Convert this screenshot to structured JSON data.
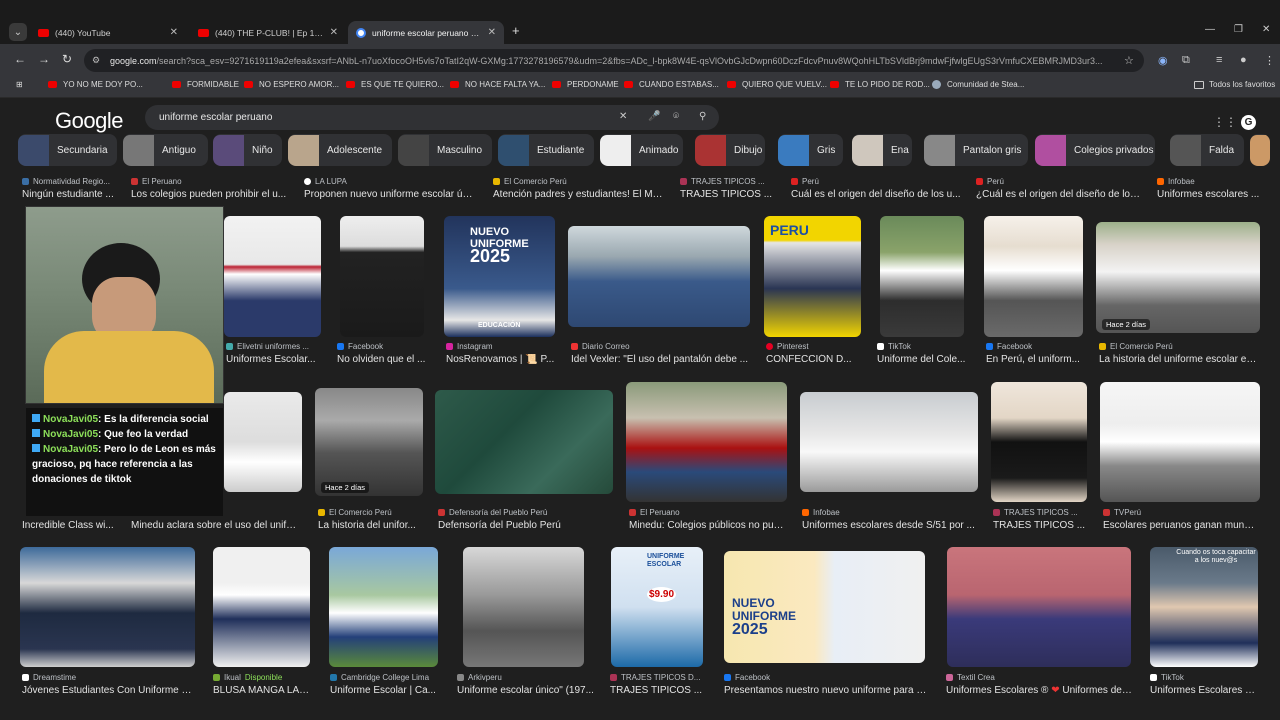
{
  "tabs": [
    {
      "title": "(440) YouTube",
      "type": "yt"
    },
    {
      "title": "(440) THE P-CLUB! | Ep 1: Desp",
      "type": "yt"
    },
    {
      "title": "uniforme escolar peruano - Bus",
      "type": "g"
    }
  ],
  "address": {
    "host": "google.com",
    "path": "/search?sca_esv=9271619119a2efea&sxsrf=ANbL-n7uoXfocoOH5vls7oTatI2qW-GXMg:1773278196579&udm=2&fbs=ADc_l-bpk8W4E-qsVlOvbGJcDwpn60DczFdcvPnuv8WQohHLTbSVldBrj9mdwFjfwlgEUgS3rVmfuCXEBMRJMD3ur3..."
  },
  "bookmarks": [
    "YO NO ME DOY PO...",
    "FORMIDABLE",
    "NO ESPERO AMOR...",
    "ES QUE TE QUIERO...",
    "NO HACE FALTA YA...",
    "PERDONAME",
    "CUANDO ESTABAS...",
    "QUIERO QUE VUELV...",
    "TE LO PIDO DE ROD...",
    "Comunidad de Stea..."
  ],
  "bookmarks_all": "Todos los favoritos",
  "google": {
    "logo": "Google",
    "query": "uniforme escolar peruano"
  },
  "chips": [
    "Secundaria",
    "Antiguo",
    "Niño",
    "Adolescente",
    "Masculino",
    "Estudiante",
    "Animado",
    "Dibujo",
    "Gris",
    "Ena",
    "Pantalon gris",
    "Colegios privados",
    "Falda"
  ],
  "top_row": [
    {
      "source": "Normatividad Regio...",
      "title": "Ningún estudiante ..."
    },
    {
      "source": "El Peruano",
      "title": "Los colegios pueden prohibir el u..."
    },
    {
      "source": "LA LUPA",
      "title": "Proponen nuevo uniforme escolar úni..."
    },
    {
      "source": "El Comercio Perú",
      "title": "Atención padres y estudiantes! El MI..."
    },
    {
      "source": "TRAJES TIPICOS ...",
      "title": "TRAJES TIPICOS ..."
    },
    {
      "source": "Perú",
      "title": "Cuál es el origen del diseño de los u..."
    },
    {
      "source": "Perú",
      "title": "¿Cuál es el origen del diseño de los..."
    },
    {
      "source": "Infobae",
      "title": "Uniformes escolares ..."
    }
  ],
  "row1": [
    {
      "source": "Elivetni uniformes ...",
      "title": "Uniformes Escolar..."
    },
    {
      "source": "Facebook",
      "title": "No olviden que el ..."
    },
    {
      "source": "Instagram",
      "title": "NosRenovamos | 📜 P..."
    },
    {
      "source": "Diario Correo",
      "title": "Idel Vexler: \"El uso del pantalón debe ..."
    },
    {
      "source": "Pinterest",
      "title": "CONFECCIÓN D..."
    },
    {
      "source": "TikTok",
      "title": "Uniforme del Cole..."
    },
    {
      "source": "Facebook",
      "title": "En Perú, el uniform..."
    },
    {
      "source": "El Comercio Perú",
      "title": "La historia del uniforme escolar en..."
    }
  ],
  "row1_overlays": {
    "nuevo": "NUEVO",
    "uniforme": "UNIFORME",
    "year": "2025",
    "educacion": "EDUCACIÓN",
    "peru_mag": "PERU",
    "badge": "Hace 2 días"
  },
  "row2": [
    {
      "source": "",
      "title": "Incredible Class wi..."
    },
    {
      "source": "",
      "title": "Minedu aclara sobre el uso del unifor..."
    },
    {
      "source": "El Comercio Perú",
      "title": "La historia del unifor..."
    },
    {
      "source": "Defensoría del Pueblo Perú",
      "title": "Defensoría del Pueblo Perú"
    },
    {
      "source": "El Peruano",
      "title": "Minedu: Colegios públicos no pue..."
    },
    {
      "source": "Infobae",
      "title": "Uniformes escolares desde S/51 por ..."
    },
    {
      "source": "TRAJES TIPICOS ...",
      "title": "TRAJES TIPICOS ..."
    },
    {
      "source": "TVPerú",
      "title": "Escolares peruanos ganan mundi..."
    }
  ],
  "row2_badge": "Hace 2 días",
  "row3": [
    {
      "source": "Dreamstime",
      "title": "Jóvenes Estudiantes Con Uniforme F..."
    },
    {
      "source": "Ikual",
      "title": "BLUSA MANGA LAR...",
      "extra": "Disponible"
    },
    {
      "source": "Cambridge College Lima",
      "title": "Uniforme Escolar | Ca..."
    },
    {
      "source": "Arkivperu",
      "title": "Uniforme escolar único\" (197..."
    },
    {
      "source": "TRAJES TIPICOS D...",
      "title": "TRAJES TIPICOS ..."
    },
    {
      "source": "Facebook",
      "title": "Presentamos nuestro nuevo uniforme para el..."
    },
    {
      "source": "Textil Crea",
      "title": "Uniformes Escolares ®",
      "title2": "Uniformes de ..."
    },
    {
      "source": "TikTok",
      "title": "Uniformes Escolares e..."
    }
  ],
  "row3_overlays": {
    "uniforme_escolar": "UNIFORME ESCOLAR",
    "price": "$9.90",
    "nuevo": "NUEVO",
    "uniforme": "UNIFORME",
    "year": "2025",
    "tiktok_caption": "Cuando os toca capacitar a los nuev@s"
  },
  "chat": [
    {
      "user": "NovaJavi05",
      "msg": ": Es la diferencia social"
    },
    {
      "user": "NovaJavi05",
      "msg": ": Que feo la verdad"
    },
    {
      "user": "NovaJavi05",
      "msg": ": Pero lo de Leon es más gracioso, pq hace referencia a las donaciones de tiktok"
    }
  ],
  "colors": {
    "bg": "#1f1f1f",
    "chip": "#303134",
    "chat_user": "#8de05a"
  }
}
